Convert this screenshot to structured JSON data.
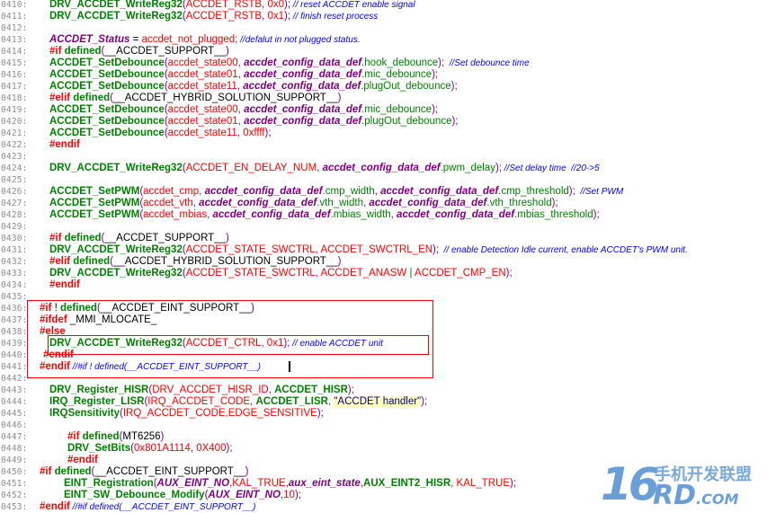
{
  "code": {
    "lines": [
      {
        "n": "0410:",
        "tokens": [
          [
            "f",
            "DRV_ACCDET_WriteReg32"
          ],
          [
            "p",
            "("
          ],
          [
            "m",
            "ACCDET_RSTB"
          ],
          [
            "p",
            ", "
          ],
          [
            "m",
            "0x0"
          ],
          [
            "p",
            ");"
          ],
          [
            "c",
            " // reset ACCDET enable signal"
          ]
        ]
      },
      {
        "n": "0411:",
        "tokens": [
          [
            "f",
            "DRV_ACCDET_WriteReg32"
          ],
          [
            "p",
            "("
          ],
          [
            "m",
            "ACCDET_RSTB"
          ],
          [
            "p",
            ", "
          ],
          [
            "m",
            "0x1"
          ],
          [
            "p",
            ");"
          ],
          [
            "c",
            " // finish reset process"
          ]
        ]
      },
      {
        "n": "0412:",
        "tokens": []
      },
      {
        "n": "0413:",
        "tokens": [
          [
            "v",
            "ACCDET_Status"
          ],
          [
            "d",
            " = "
          ],
          [
            "m",
            "accdet_not_plugged"
          ],
          [
            "p",
            ";"
          ],
          [
            "c",
            " //defalut in not plugged status."
          ]
        ]
      },
      {
        "n": "0414:",
        "tokens": [
          [
            "k",
            "#if "
          ],
          [
            "b",
            "defined"
          ],
          [
            "p",
            "("
          ],
          [
            "d",
            "__ACCDET_SUPPORT__"
          ],
          [
            "p",
            ")"
          ]
        ]
      },
      {
        "n": "0415:",
        "tokens": [
          [
            "f",
            "ACCDET_SetDebounce"
          ],
          [
            "p",
            "("
          ],
          [
            "m",
            "accdet_state00"
          ],
          [
            "p",
            ", "
          ],
          [
            "v",
            "accdet_config_data_def"
          ],
          [
            "g",
            ".hook_debounce"
          ],
          [
            "p",
            ");"
          ],
          [
            "c",
            "  //Set debounce time"
          ]
        ]
      },
      {
        "n": "0416:",
        "tokens": [
          [
            "f",
            "ACCDET_SetDebounce"
          ],
          [
            "p",
            "("
          ],
          [
            "m",
            "accdet_state01"
          ],
          [
            "p",
            ", "
          ],
          [
            "v",
            "accdet_config_data_def"
          ],
          [
            "g",
            ".mic_debounce"
          ],
          [
            "p",
            ");"
          ]
        ]
      },
      {
        "n": "0417:",
        "tokens": [
          [
            "f",
            "ACCDET_SetDebounce"
          ],
          [
            "p",
            "("
          ],
          [
            "m",
            "accdet_state11"
          ],
          [
            "p",
            ", "
          ],
          [
            "v",
            "accdet_config_data_def"
          ],
          [
            "g",
            ".plugOut_debounce"
          ],
          [
            "p",
            ");"
          ]
        ]
      },
      {
        "n": "0418:",
        "tokens": [
          [
            "k",
            "#elif "
          ],
          [
            "b",
            "defined"
          ],
          [
            "p",
            "("
          ],
          [
            "d",
            "__ACCDET_HYBRID_SOLUTION_SUPPORT__"
          ],
          [
            "p",
            ")"
          ]
        ]
      },
      {
        "n": "0419:",
        "tokens": [
          [
            "f",
            "ACCDET_SetDebounce"
          ],
          [
            "p",
            "("
          ],
          [
            "m",
            "accdet_state00"
          ],
          [
            "p",
            ", "
          ],
          [
            "v",
            "accdet_config_data_def"
          ],
          [
            "g",
            ".mic_debounce"
          ],
          [
            "p",
            ");"
          ]
        ]
      },
      {
        "n": "0420:",
        "tokens": [
          [
            "f",
            "ACCDET_SetDebounce"
          ],
          [
            "p",
            "("
          ],
          [
            "m",
            "accdet_state01"
          ],
          [
            "p",
            ", "
          ],
          [
            "v",
            "accdet_config_data_def"
          ],
          [
            "g",
            ".plugOut_debounce"
          ],
          [
            "p",
            ");"
          ]
        ]
      },
      {
        "n": "0421:",
        "tokens": [
          [
            "f",
            "ACCDET_SetDebounce"
          ],
          [
            "p",
            "("
          ],
          [
            "m",
            "accdet_state11"
          ],
          [
            "p",
            ", "
          ],
          [
            "m",
            "0xffff"
          ],
          [
            "p",
            ");"
          ]
        ]
      },
      {
        "n": "0422:",
        "tokens": [
          [
            "k",
            "#endif"
          ]
        ]
      },
      {
        "n": "0423:",
        "tokens": []
      },
      {
        "n": "0424:",
        "tokens": [
          [
            "f",
            "DRV_ACCDET_WriteReg32"
          ],
          [
            "p",
            "("
          ],
          [
            "m",
            "ACCDET_EN_DELAY_NUM"
          ],
          [
            "p",
            ", "
          ],
          [
            "v",
            "accdet_config_data_def"
          ],
          [
            "g",
            ".pwm_delay"
          ],
          [
            "p",
            ");"
          ],
          [
            "c",
            " //Set delay time  //20->5"
          ]
        ]
      },
      {
        "n": "0425:",
        "tokens": []
      },
      {
        "n": "0426:",
        "tokens": [
          [
            "f",
            "ACCDET_SetPWM"
          ],
          [
            "p",
            "("
          ],
          [
            "m",
            "accdet_cmp"
          ],
          [
            "p",
            ", "
          ],
          [
            "v",
            "accdet_config_data_def"
          ],
          [
            "g",
            ".cmp_width"
          ],
          [
            "p",
            ", "
          ],
          [
            "v",
            "accdet_config_data_def"
          ],
          [
            "g",
            ".cmp_threshold"
          ],
          [
            "p",
            ");"
          ],
          [
            "c",
            "  //Set PWM"
          ]
        ]
      },
      {
        "n": "0427:",
        "tokens": [
          [
            "f",
            "ACCDET_SetPWM"
          ],
          [
            "p",
            "("
          ],
          [
            "m",
            "accdet_vth"
          ],
          [
            "p",
            ", "
          ],
          [
            "v",
            "accdet_config_data_def"
          ],
          [
            "g",
            ".vth_width"
          ],
          [
            "p",
            ", "
          ],
          [
            "v",
            "accdet_config_data_def"
          ],
          [
            "g",
            ".vth_threshold"
          ],
          [
            "p",
            ");"
          ]
        ]
      },
      {
        "n": "0428:",
        "tokens": [
          [
            "f",
            "ACCDET_SetPWM"
          ],
          [
            "p",
            "("
          ],
          [
            "m",
            "accdet_mbias"
          ],
          [
            "p",
            ", "
          ],
          [
            "v",
            "accdet_config_data_def"
          ],
          [
            "g",
            ".mbias_width"
          ],
          [
            "p",
            ", "
          ],
          [
            "v",
            "accdet_config_data_def"
          ],
          [
            "g",
            ".mbias_threshold"
          ],
          [
            "p",
            ");"
          ]
        ]
      },
      {
        "n": "0429:",
        "tokens": []
      },
      {
        "n": "0430:",
        "tokens": [
          [
            "k",
            "#if "
          ],
          [
            "b",
            "defined"
          ],
          [
            "p",
            "("
          ],
          [
            "d",
            "__ACCDET_SUPPORT__"
          ],
          [
            "p",
            ")"
          ]
        ]
      },
      {
        "n": "0431:",
        "tokens": [
          [
            "f",
            "DRV_ACCDET_WriteReg32"
          ],
          [
            "p",
            "("
          ],
          [
            "m",
            "ACCDET_STATE_SWCTRL"
          ],
          [
            "p",
            ", "
          ],
          [
            "m",
            "ACCDET_SWCTRL_EN"
          ],
          [
            "p",
            ");"
          ],
          [
            "c",
            "  // enable Detection Idle current, enable ACCDET's PWM unit."
          ]
        ]
      },
      {
        "n": "0432:",
        "tokens": [
          [
            "k",
            "#elif "
          ],
          [
            "b",
            "defined"
          ],
          [
            "p",
            "("
          ],
          [
            "d",
            "__ACCDET_HYBRID_SOLUTION_SUPPORT__"
          ],
          [
            "p",
            ")"
          ]
        ]
      },
      {
        "n": "0433:",
        "tokens": [
          [
            "f",
            "DRV_ACCDET_WriteReg32"
          ],
          [
            "p",
            "("
          ],
          [
            "m",
            "ACCDET_STATE_SWCTRL"
          ],
          [
            "p",
            ", "
          ],
          [
            "m",
            "ACCDET_ANASW"
          ],
          [
            "g",
            " | "
          ],
          [
            "m",
            "ACCDET_CMP_EN"
          ],
          [
            "p",
            ");"
          ]
        ]
      },
      {
        "n": "0434:",
        "tokens": [
          [
            "k",
            "#endif"
          ]
        ]
      },
      {
        "n": "0435:",
        "tokens": []
      },
      {
        "n": "0436:",
        "tokens": [
          [
            "k",
            "#if "
          ],
          [
            "d",
            "! "
          ],
          [
            "b",
            "defined"
          ],
          [
            "p",
            "("
          ],
          [
            "d",
            "__ACCDET_EINT_SUPPORT__"
          ],
          [
            "p",
            ")"
          ]
        ]
      },
      {
        "n": "0437:",
        "tokens": [
          [
            "k",
            "#ifdef "
          ],
          [
            "d",
            "_MMI_MLOCATE_"
          ]
        ]
      },
      {
        "n": "0438:",
        "tokens": [
          [
            "k",
            "#else"
          ]
        ]
      },
      {
        "n": "0439:",
        "tokens": [
          [
            "f",
            "DRV_ACCDET_WriteReg32"
          ],
          [
            "p",
            "("
          ],
          [
            "m",
            "ACCDET_CTRL"
          ],
          [
            "p",
            ", "
          ],
          [
            "m",
            "0x1"
          ],
          [
            "p",
            ");"
          ],
          [
            "c",
            " // enable ACCDET unit"
          ]
        ]
      },
      {
        "n": "0440:",
        "tokens": [
          [
            "k",
            "#endif"
          ]
        ]
      },
      {
        "n": "0441:",
        "tokens": [
          [
            "k",
            "#endif"
          ],
          [
            "c",
            " //#if ! defined(__ACCDET_EINT_SUPPORT__)"
          ]
        ]
      },
      {
        "n": "0442:",
        "tokens": []
      },
      {
        "n": "0443:",
        "tokens": [
          [
            "f",
            "DRV_Register_HISR"
          ],
          [
            "p",
            "("
          ],
          [
            "m",
            "DRV_ACCDET_HISR_ID"
          ],
          [
            "p",
            ", "
          ],
          [
            "f",
            "ACCDET_HISR"
          ],
          [
            "p",
            ");"
          ]
        ]
      },
      {
        "n": "0444:",
        "tokens": [
          [
            "f",
            "IRQ_Register_LISR"
          ],
          [
            "p",
            "("
          ],
          [
            "m",
            "IRQ_ACCDET_CODE"
          ],
          [
            "p",
            ", "
          ],
          [
            "f",
            "ACCDET_LISR"
          ],
          [
            "p",
            ", "
          ],
          [
            "s",
            "\"ACCDET handler\""
          ],
          [
            "p",
            ");"
          ]
        ]
      },
      {
        "n": "0445:",
        "tokens": [
          [
            "f",
            "IRQSensitivity"
          ],
          [
            "p",
            "("
          ],
          [
            "m",
            "IRQ_ACCDET_CODE,EDGE_SENSITIVE"
          ],
          [
            "p",
            ");"
          ]
        ]
      },
      {
        "n": "0446:",
        "tokens": []
      },
      {
        "n": "0447:",
        "tokens": [
          [
            "k",
            "#if "
          ],
          [
            "b",
            "defined"
          ],
          [
            "p",
            "("
          ],
          [
            "d",
            "MT6256"
          ],
          [
            "p",
            ")"
          ]
        ]
      },
      {
        "n": "0448:",
        "tokens": [
          [
            "f",
            "DRV_SetBits"
          ],
          [
            "p",
            "("
          ],
          [
            "m",
            "0x801A1114"
          ],
          [
            "p",
            ", "
          ],
          [
            "m",
            "0X400"
          ],
          [
            "p",
            ");"
          ]
        ]
      },
      {
        "n": "0449:",
        "tokens": [
          [
            "k",
            "#endif"
          ]
        ]
      },
      {
        "n": "0450:",
        "tokens": [
          [
            "k",
            "#if "
          ],
          [
            "b",
            "defined"
          ],
          [
            "p",
            "("
          ],
          [
            "d",
            "__ACCDET_EINT_SUPPORT__"
          ],
          [
            "p",
            ")"
          ]
        ]
      },
      {
        "n": "0451:",
        "tokens": [
          [
            "f",
            "EINT_Registration"
          ],
          [
            "p",
            "("
          ],
          [
            "v",
            "AUX_EINT_NO"
          ],
          [
            "p",
            ","
          ],
          [
            "m",
            "KAL_TRUE"
          ],
          [
            "p",
            ","
          ],
          [
            "v",
            "aux_eint_state"
          ],
          [
            "p",
            ","
          ],
          [
            "f",
            "AUX_EINT2_HISR"
          ],
          [
            "p",
            ", "
          ],
          [
            "m",
            "KAL_TRUE"
          ],
          [
            "p",
            ");"
          ]
        ]
      },
      {
        "n": "0452:",
        "tokens": [
          [
            "f",
            "EINT_SW_Debounce_Modify"
          ],
          [
            "p",
            "("
          ],
          [
            "v",
            "AUX_EINT_NO"
          ],
          [
            "p",
            ","
          ],
          [
            "m",
            "10"
          ],
          [
            "p",
            ");"
          ]
        ]
      },
      {
        "n": "0453:",
        "tokens": [
          [
            "k",
            "#endif"
          ],
          [
            "c",
            " //#if defined(__ACCDET_EINT_SUPPORT__)"
          ]
        ]
      }
    ]
  },
  "watermark": {
    "number": "16",
    "cn": "手机开发联盟",
    "domain": "RD",
    "tld": ".COM"
  },
  "colors": {
    "function": "#008000",
    "macro": "#ff0000",
    "paren": "#800080",
    "comment": "#0000ff",
    "highlight_box": "#ff0000",
    "line_number": "#8c8c8c"
  }
}
